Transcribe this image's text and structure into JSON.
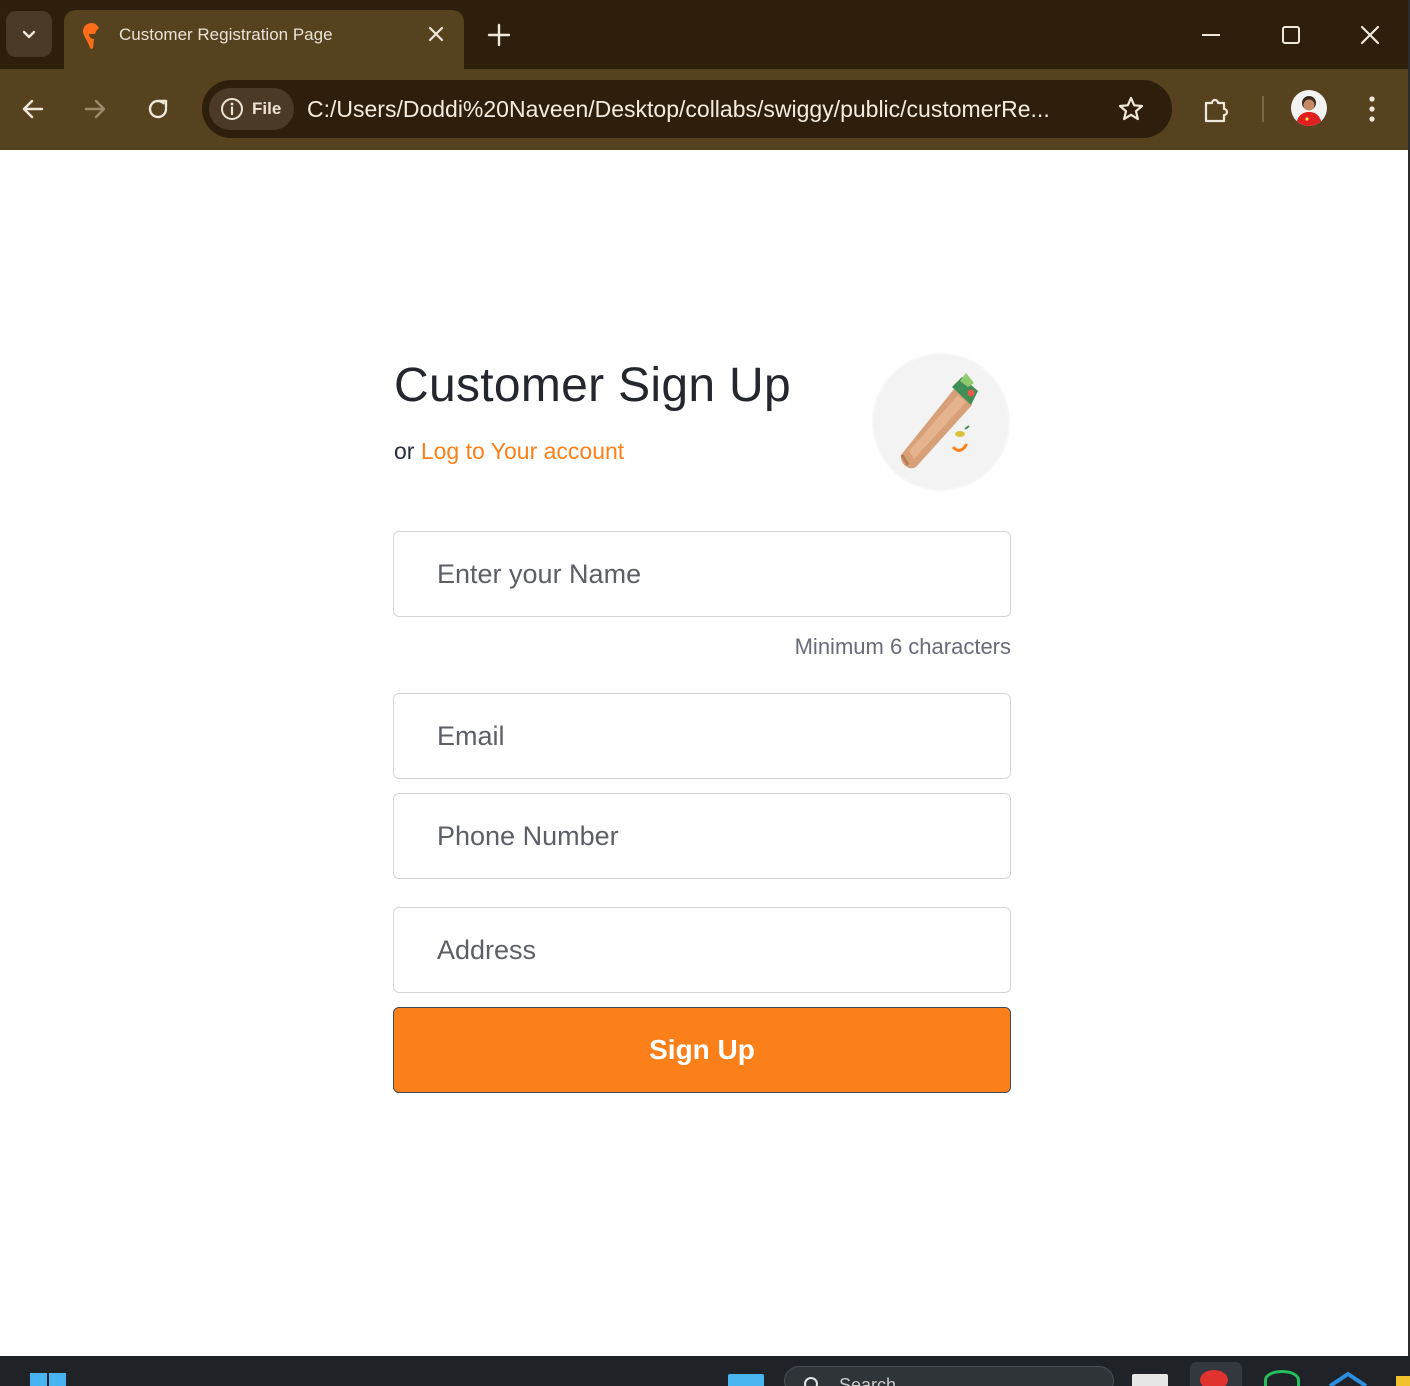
{
  "browser": {
    "tab_title": "Customer Registration Page",
    "site_chip_label": "File",
    "url": "C:/Users/Doddi%20Naveen/Desktop/collabs/swiggy/public/customerRe...",
    "icons": [
      "tab-search-icon",
      "swiggy-favicon-icon",
      "close-icon",
      "plus-icon",
      "minimize-icon",
      "maximize-icon",
      "close-window-icon",
      "back-arrow-icon",
      "forward-arrow-icon",
      "reload-icon",
      "info-icon",
      "star-icon",
      "extensions-icon",
      "profile-avatar",
      "more-vertical-icon"
    ]
  },
  "form": {
    "heading": "Customer Sign Up",
    "subline_prefix": "or",
    "login_link": "Log to Your account",
    "name_placeholder": "Enter your Name",
    "name_hint": "Minimum 6 characters",
    "email_placeholder": "Email",
    "phone_placeholder": "Phone Number",
    "address_placeholder": "Address",
    "submit_label": "Sign Up"
  },
  "taskbar": {
    "search_label": "Search"
  },
  "colors": {
    "accent": "#fc8019",
    "titlebar": "#2e1f0c",
    "toolbar": "#56421f",
    "heading_text": "#24272e",
    "hint_text": "#686b78"
  }
}
